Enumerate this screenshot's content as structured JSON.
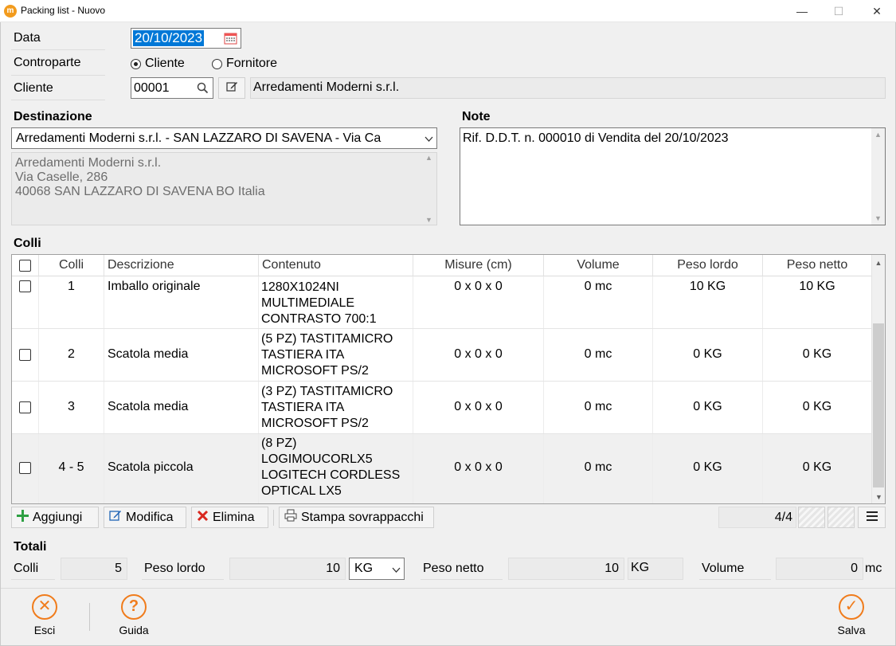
{
  "window": {
    "title": "Packing list - Nuovo",
    "minimize": "—",
    "maximize": "☐",
    "close": "✕"
  },
  "form": {
    "data_label": "Data",
    "data_value": "20/10/2023",
    "controparte_label": "Controparte",
    "radio_cliente": "Cliente",
    "radio_fornitore": "Fornitore",
    "cliente_label": "Cliente",
    "cliente_code": "00001",
    "cliente_name": "Arredamenti Moderni s.r.l."
  },
  "destinazione": {
    "label": "Destinazione",
    "selected": "Arredamenti Moderni s.r.l. - SAN LAZZARO DI SAVENA - Via Ca",
    "address_lines": [
      "Arredamenti Moderni s.r.l.",
      "Via Caselle, 286",
      "40068 SAN LAZZARO DI SAVENA BO Italia"
    ]
  },
  "note": {
    "label": "Note",
    "text": "Rif. D.D.T. n. 000010 di Vendita del 20/10/2023"
  },
  "colli": {
    "label": "Colli",
    "columns": [
      "Colli",
      "Descrizione",
      "Contenuto",
      "Misure (cm)",
      "Volume",
      "Peso lordo",
      "Peso netto"
    ],
    "rows": [
      {
        "colli": "1",
        "descrizione": "Imballo originale",
        "contenuto": [
          "1280X1024NI",
          "MULTIMEDIALE",
          "CONTRASTO 700:1"
        ],
        "misure": "0 x 0 x 0",
        "volume": "0 mc",
        "peso_lordo": "10 KG",
        "peso_netto": "10 KG"
      },
      {
        "colli": "2",
        "descrizione": "Scatola media",
        "contenuto": [
          "(5 PZ) TASTITAMICRO",
          "TASTIERA ITA",
          "MICROSOFT PS/2"
        ],
        "misure": "0 x 0 x 0",
        "volume": "0 mc",
        "peso_lordo": "0 KG",
        "peso_netto": "0 KG"
      },
      {
        "colli": "3",
        "descrizione": "Scatola media",
        "contenuto": [
          "(3 PZ) TASTITAMICRO",
          "TASTIERA ITA",
          "MICROSOFT PS/2"
        ],
        "misure": "0 x 0 x 0",
        "volume": "0 mc",
        "peso_lordo": "0 KG",
        "peso_netto": "0 KG"
      },
      {
        "colli": "4 - 5",
        "descrizione": "Scatola piccola",
        "contenuto": [
          "(8 PZ)",
          "LOGIMOUCORLX5",
          "LOGITECH CORDLESS",
          "OPTICAL LX5"
        ],
        "misure": "0 x 0 x 0",
        "volume": "0 mc",
        "peso_lordo": "0 KG",
        "peso_netto": "0 KG"
      }
    ]
  },
  "toolbar": {
    "add": "Aggiungi",
    "edit": "Modifica",
    "delete": "Elimina",
    "print": "Stampa sovrappacchi",
    "counter": "4/4"
  },
  "totali": {
    "label": "Totali",
    "colli_label": "Colli",
    "colli_value": "5",
    "peso_lordo_label": "Peso lordo",
    "peso_lordo_value": "10",
    "peso_lordo_unit": "KG",
    "peso_netto_label": "Peso netto",
    "peso_netto_value": "10",
    "peso_netto_unit": "KG",
    "volume_label": "Volume",
    "volume_value": "0",
    "volume_unit": "mc"
  },
  "footer": {
    "exit": "Esci",
    "help": "Guida",
    "save": "Salva"
  },
  "colors": {
    "accent": "#f07c1c",
    "selection": "#0078d7",
    "add_green": "#2ea043",
    "delete_red": "#d9281f"
  }
}
